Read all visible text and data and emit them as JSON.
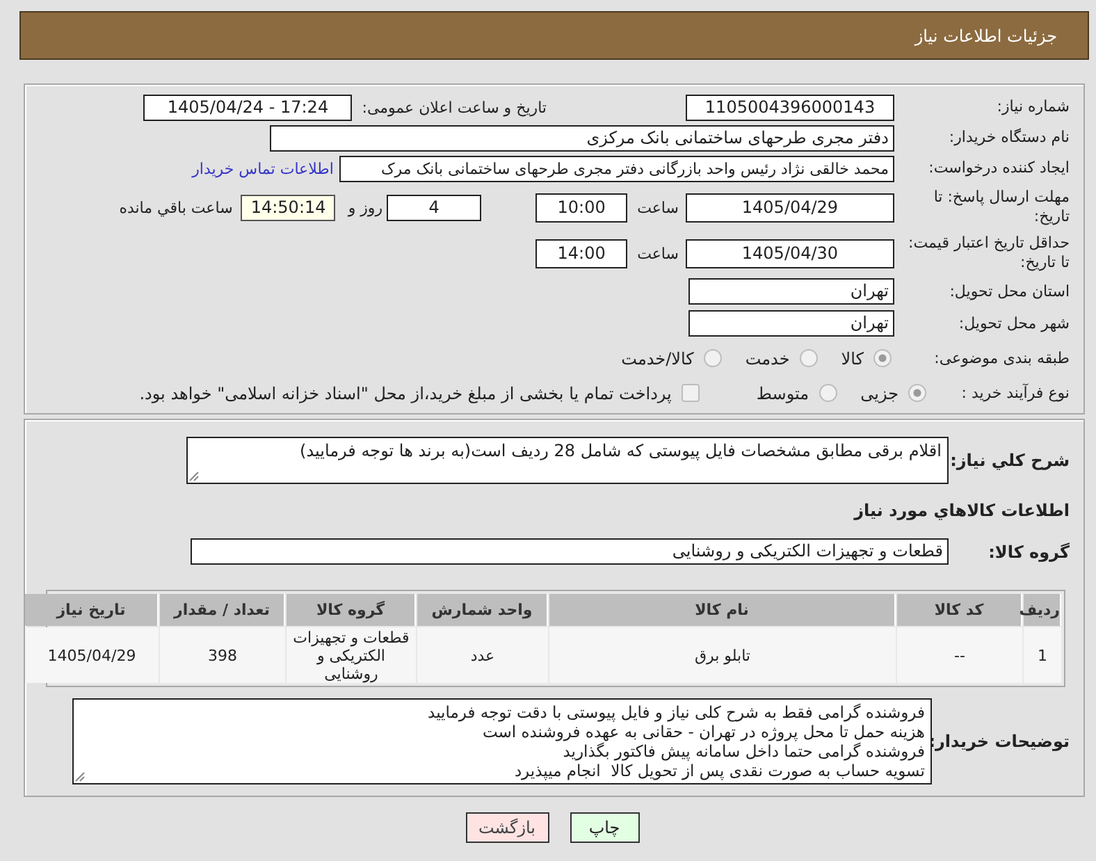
{
  "header": {
    "title": "جزئیات اطلاعات نیاز"
  },
  "details": {
    "need_number": {
      "label": "شماره نیاز:",
      "value": "1105004396000143"
    },
    "announcement": {
      "label": "تاریخ و ساعت اعلان عمومی:",
      "value": "1405/04/24 - 17:24"
    },
    "buyer_org": {
      "label": "نام دستگاه خریدار:",
      "value": "دفتر مجری طرحهای ساختمانی بانک مرکزی"
    },
    "requester": {
      "label": "ایجاد کننده درخواست:",
      "value": "محمد خالقی نژاد رئیس واحد بازرگانی دفتر مجری طرحهای ساختمانی بانک مرک",
      "contact_link": "اطلاعات تماس خریدار"
    },
    "reply_deadline": {
      "label": "مهلت ارسال پاسخ: تا تاریخ:",
      "date": "1405/04/29",
      "time_label": "ساعت",
      "time": "10:00",
      "days": "4",
      "days_label": "روز و",
      "remaining": "14:50:14",
      "remaining_label": "ساعت باقي مانده"
    },
    "price_validity": {
      "label": "حداقل تاریخ اعتبار قیمت: تا تاریخ:",
      "date": "1405/04/30",
      "time_label": "ساعت",
      "time": "14:00"
    },
    "delivery_province": {
      "label": "استان محل تحویل:",
      "value": "تهران"
    },
    "delivery_city": {
      "label": "شهر محل تحویل:",
      "value": "تهران"
    },
    "subject_category": {
      "label": "طبقه بندی موضوعی:",
      "options": [
        {
          "label": "کالا",
          "selected": true,
          "disabled": true
        },
        {
          "label": "خدمت",
          "selected": false,
          "disabled": true
        },
        {
          "label": "کالا/خدمت",
          "selected": false,
          "disabled": true
        }
      ]
    },
    "purchase_process": {
      "label": "نوع فرآیند خرید :",
      "options": [
        {
          "label": "جزیی",
          "selected": true,
          "disabled": true
        },
        {
          "label": "متوسط",
          "selected": false,
          "disabled": true
        }
      ],
      "treasury_payment": {
        "label": "پرداخت تمام یا بخشی از مبلغ خرید،از محل \"اسناد خزانه اسلامی\" خواهد بود.",
        "checked": false,
        "disabled": true
      }
    }
  },
  "requirements": {
    "general_description": {
      "label": "شرح کلي نیاز:",
      "value": "اقلام برقی مطابق مشخصات فایل پیوستی که شامل 28 ردیف است(به برند ها توجه فرمایید)"
    },
    "goods_heading": "اطلاعات کالاهاي مورد نیاز",
    "goods_group": {
      "label": "گروه کالا:",
      "value": "قطعات و تجهیزات الکتریکی و روشنایی"
    },
    "table": {
      "columns": [
        "ردیف",
        "کد کالا",
        "نام کالا",
        "واحد شمارش",
        "گروه کالا",
        "تعداد / مقدار",
        "تاریخ نیاز"
      ],
      "rows": [
        [
          "1",
          "--",
          "تابلو برق",
          "عدد",
          "قطعات و تجهیزات الکتریکی و روشنایی",
          "398",
          "1405/04/29"
        ]
      ]
    },
    "buyer_notes": {
      "label": "توضیحات خریدار:",
      "value": "فروشنده گرامی فقط به شرح کلی نیاز و فایل پیوستی با دقت توجه فرمایید\nهزینه حمل تا محل پروژه در تهران - حقانی به عهده فروشنده است\nفروشنده گرامی حتما داخل سامانه پیش فاکتور بگذارید\nتسویه حساب به صورت نقدی پس از تحویل کالا  انجام میپذیرد"
    }
  },
  "buttons": [
    {
      "label": "چاپ",
      "kind": "print"
    },
    {
      "label": "بازگشت",
      "kind": "back"
    }
  ]
}
